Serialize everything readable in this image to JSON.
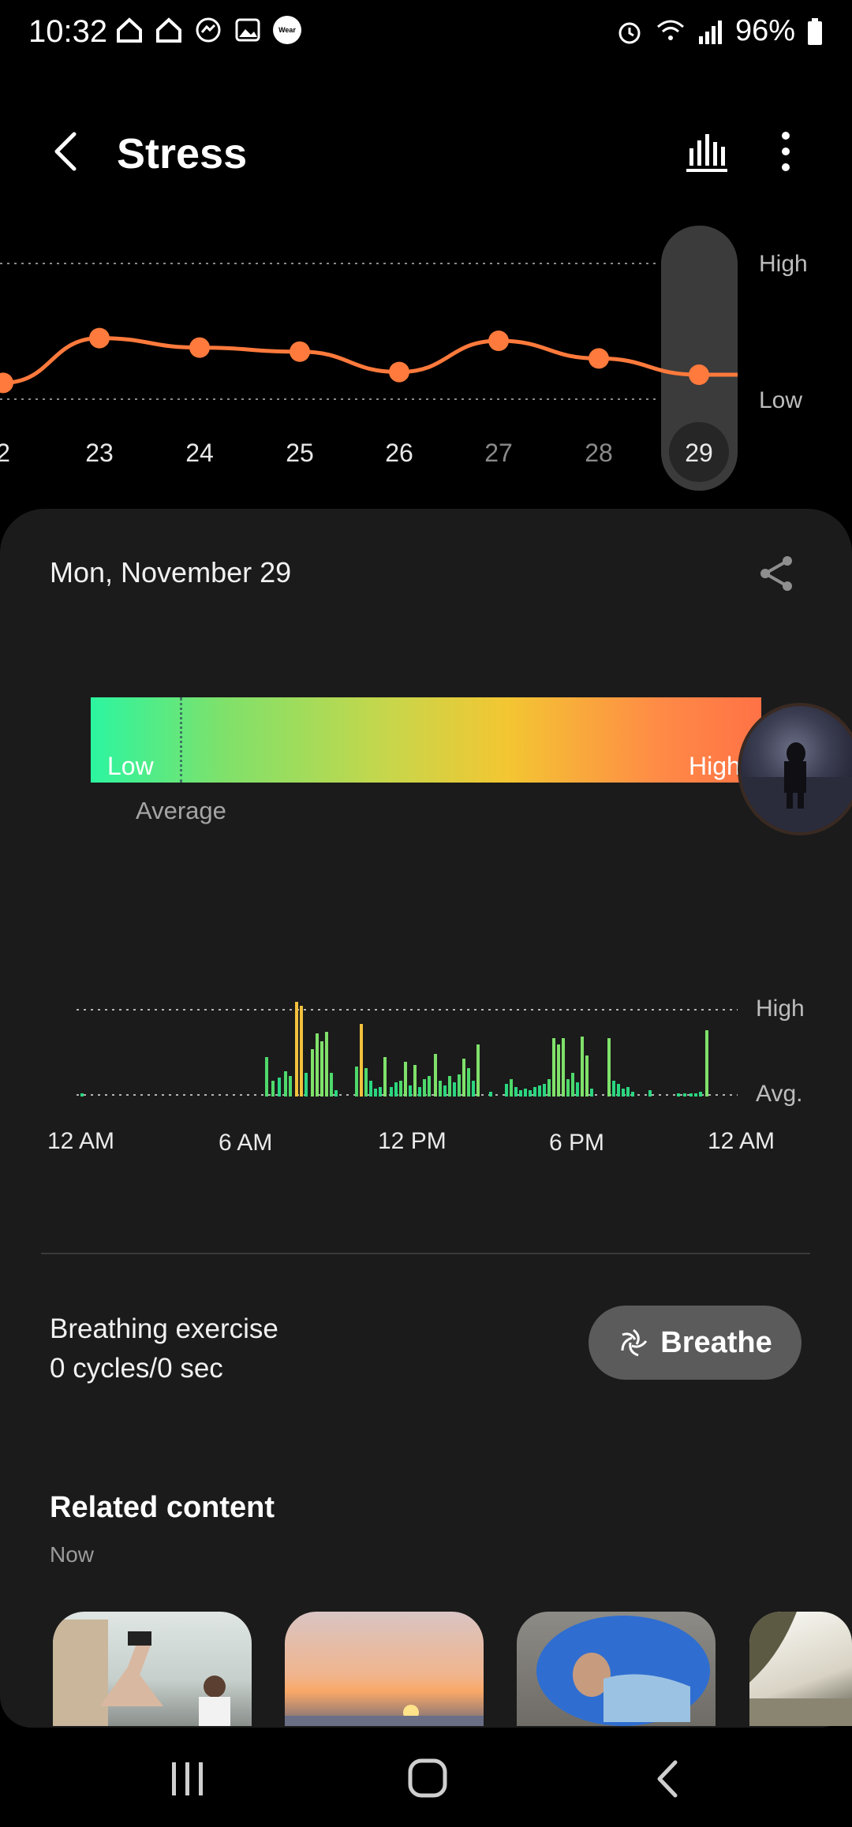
{
  "status_bar": {
    "time": "10:32",
    "battery": "96%",
    "left_icons": [
      "home-icon",
      "home-icon",
      "messenger-icon",
      "gallery-icon",
      "wear-icon"
    ],
    "wear_label": "Wear",
    "right_icons": [
      "alarm-icon",
      "wifi-icon",
      "signal-icon",
      "battery-icon"
    ]
  },
  "header": {
    "title": "Stress"
  },
  "trend": {
    "high_label": "High",
    "low_label": "Low",
    "days": [
      "2",
      "23",
      "24",
      "25",
      "26",
      "27",
      "28",
      "29"
    ],
    "selected_day": "29",
    "level_values": [
      0.12,
      0.45,
      0.38,
      0.35,
      0.2,
      0.43,
      0.3,
      0.18
    ],
    "line_color": "#ff7a3c"
  },
  "detail": {
    "date": "Mon, November 29",
    "gauge_low": "Low",
    "gauge_high": "High",
    "gauge_average_label": "Average",
    "average_position": 0.13,
    "chart_high": "High",
    "chart_avg": "Avg.",
    "time_labels": [
      "12 AM",
      "6 AM",
      "12 PM",
      "6 PM",
      "12 AM"
    ]
  },
  "breathing": {
    "title": "Breathing exercise",
    "subtitle": "0 cycles/0 sec",
    "button_label": "Breathe"
  },
  "related": {
    "title": "Related content",
    "subtitle": "Now"
  }
}
